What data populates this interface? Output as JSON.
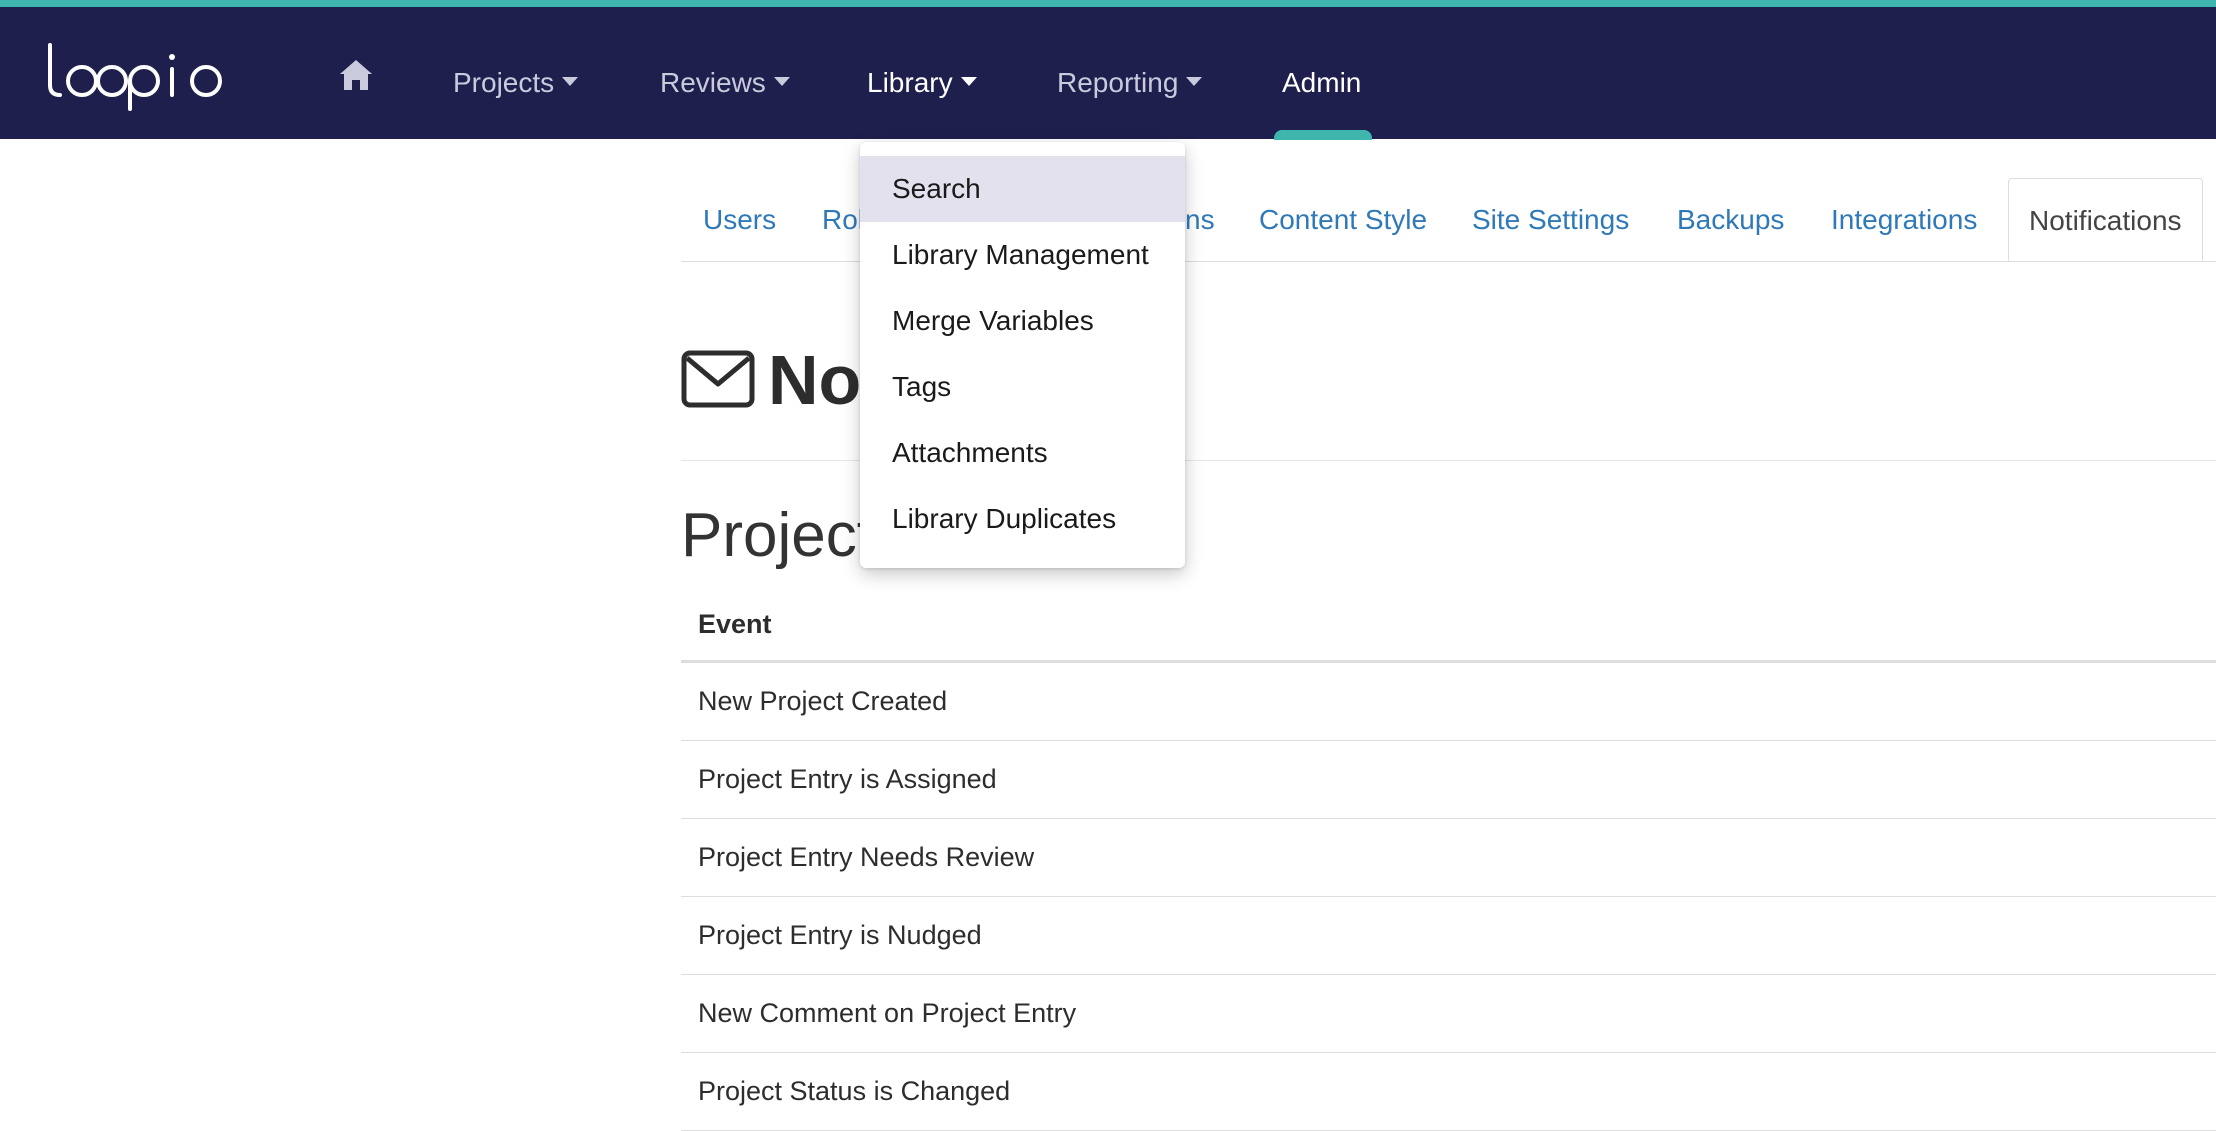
{
  "app": {
    "logo_text": "loopio"
  },
  "nav": {
    "items": [
      {
        "label": "Projects"
      },
      {
        "label": "Reviews"
      },
      {
        "label": "Library"
      },
      {
        "label": "Reporting"
      },
      {
        "label": "Admin"
      }
    ],
    "icons": {
      "home": "home-icon",
      "caret": "chevron-down-icon"
    }
  },
  "library_menu": {
    "items": [
      {
        "label": "Search"
      },
      {
        "label": "Library Management"
      },
      {
        "label": "Merge Variables"
      },
      {
        "label": "Tags"
      },
      {
        "label": "Attachments"
      },
      {
        "label": "Library Duplicates"
      }
    ]
  },
  "admin_tabs": {
    "items": [
      {
        "label": "Users"
      },
      {
        "label": "Rol"
      },
      {
        "label": "ns"
      },
      {
        "label": "Content Style"
      },
      {
        "label": "Site Settings"
      },
      {
        "label": "Backups"
      },
      {
        "label": "Integrations"
      },
      {
        "label": "Notifications"
      }
    ]
  },
  "page": {
    "title": "No",
    "title_icon": "envelope-icon",
    "section_title": "Project"
  },
  "table": {
    "header": "Event",
    "rows": [
      "New Project Created",
      "Project Entry is Assigned",
      "Project Entry Needs Review",
      "Project Entry is Nudged",
      "New Comment on Project Entry",
      "Project Status is Changed"
    ]
  },
  "colors": {
    "navbar_bg": "#1f1f4d",
    "accent": "#3fb6ad",
    "link": "#2f79b8",
    "menu_highlight": "#e2e1ed"
  }
}
